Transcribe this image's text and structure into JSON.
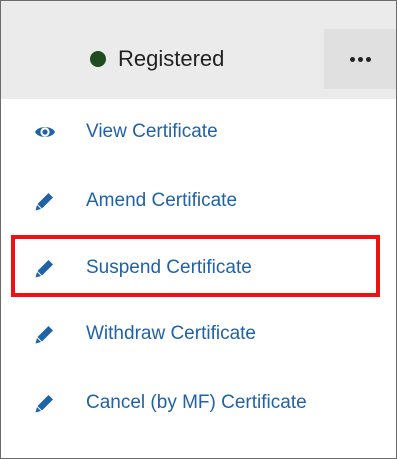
{
  "status": {
    "label": "Registered",
    "dot_color": "#1f4d1f"
  },
  "more_button": {
    "icon": "more-horizontal-icon"
  },
  "menu": {
    "accent_color": "#1f62a8",
    "items": [
      {
        "label": "View Certificate",
        "icon": "eye-icon"
      },
      {
        "label": "Amend Certificate",
        "icon": "pencil-icon"
      },
      {
        "label": "Suspend Certificate",
        "icon": "pencil-icon",
        "highlighted": true
      },
      {
        "label": "Withdraw Certificate",
        "icon": "pencil-icon"
      },
      {
        "label": "Cancel (by MF) Certificate",
        "icon": "pencil-icon"
      }
    ]
  },
  "highlight_color": "#ee1111"
}
